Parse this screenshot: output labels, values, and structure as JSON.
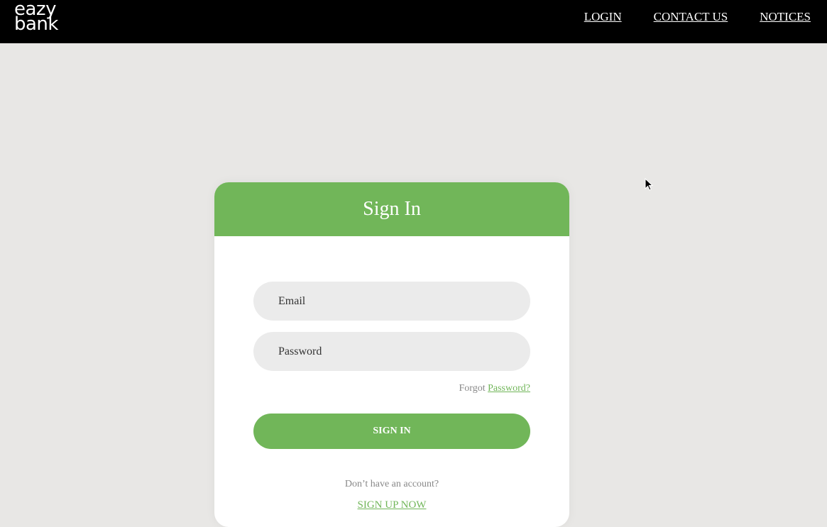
{
  "logo": {
    "line1": "eazy",
    "line2": "bank"
  },
  "nav": {
    "login": "LOGIN",
    "contact": "CONTACT US",
    "notices": "NOTICES"
  },
  "signin_card": {
    "title": "Sign In",
    "email_placeholder": "Email",
    "password_placeholder": "Password",
    "forgot_prefix": "Forgot",
    "forgot_link": "Password?",
    "button": "SIGN IN",
    "no_account": "Don’t have an account?",
    "signup_link": "SIGN UP NOW"
  },
  "colors": {
    "accent": "#71b659",
    "navbar": "#000000",
    "background": "#e8e7e5",
    "input": "#ebebeb"
  },
  "icons": {
    "cursor": "mouse-pointer-icon"
  }
}
